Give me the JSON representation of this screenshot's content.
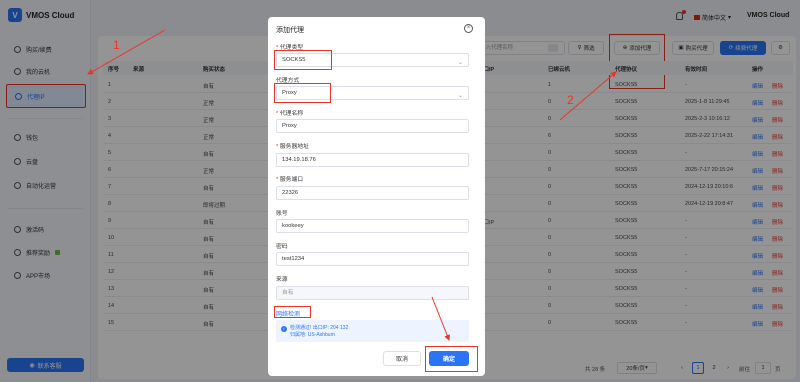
{
  "app": {
    "name": "VMOS Cloud",
    "logo_letter": "V"
  },
  "sidebar": {
    "items": [
      {
        "label": "购买/续费",
        "icon": "plus-circle-icon"
      },
      {
        "label": "我的云机",
        "icon": "phone-icon"
      },
      {
        "label": "代理IP",
        "icon": "globe-icon",
        "active": true
      },
      {
        "label": "钱包",
        "icon": "wallet-icon"
      },
      {
        "label": "云盘",
        "icon": "cloud-icon"
      },
      {
        "label": "自动化运营",
        "icon": "automation-icon"
      },
      {
        "label": "激活码",
        "icon": "code-icon"
      },
      {
        "label": "推荐奖励",
        "icon": "gift-icon"
      },
      {
        "label": "APP市场",
        "icon": "store-icon"
      }
    ],
    "support_button": "联系客服"
  },
  "topbar": {
    "language": "简体中文",
    "user": "VMOS Cloud"
  },
  "toolbar": {
    "search_placeholder": "输入代理名称",
    "filter_label": "筛选",
    "add_proxy_label": "添加代理",
    "buy_proxy_label": "购买代理",
    "renew_label": "续费代理"
  },
  "table": {
    "headers": [
      "序号",
      "来源",
      "购买状态",
      "出口IP",
      "已绑云机",
      "代理协议",
      "有效时间",
      "操作"
    ],
    "rows": [
      {
        "no": "1",
        "status": "自有",
        "ip": "",
        "bound": "1",
        "protocol": "SOCKS5",
        "time": "-"
      },
      {
        "no": "2",
        "status": "正常",
        "ip": "",
        "bound": "0",
        "protocol": "SOCKS5",
        "time": "2025-1-8 11:29:45"
      },
      {
        "no": "3",
        "status": "正常",
        "ip": "",
        "bound": "0",
        "protocol": "SOCKS5",
        "time": "2025-2-3 10:16:12"
      },
      {
        "no": "4",
        "status": "正常",
        "ip": "",
        "bound": "6",
        "protocol": "SOCKS5",
        "time": "2025-2-22 17:14:31"
      },
      {
        "no": "5",
        "status": "自有",
        "ip": "",
        "bound": "0",
        "protocol": "SOCKS5",
        "time": "-"
      },
      {
        "no": "6",
        "status": "正常",
        "ip": "",
        "bound": "0",
        "protocol": "SOCKS5",
        "time": "2025-7-17 20:15:24"
      },
      {
        "no": "7",
        "status": "自有",
        "ip": "",
        "bound": "0",
        "protocol": "SOCKS5",
        "time": "2024-12-19 20:10:6"
      },
      {
        "no": "8",
        "status": "即将过期",
        "ip": "",
        "bound": "0",
        "protocol": "SOCKS5",
        "time": "2024-12-19 20:8:47"
      },
      {
        "no": "9",
        "status": "自有",
        "ip": "出口IP",
        "bound": "0",
        "protocol": "SOCKS5",
        "time": "-"
      },
      {
        "no": "10",
        "status": "自有",
        "ip": "",
        "bound": "0",
        "protocol": "SOCKS5",
        "time": "-"
      },
      {
        "no": "11",
        "status": "自有",
        "ip": "",
        "bound": "0",
        "protocol": "SOCKS5",
        "time": "-"
      },
      {
        "no": "12",
        "status": "自有",
        "ip": "",
        "bound": "0",
        "protocol": "SOCKS5",
        "time": "-"
      },
      {
        "no": "13",
        "status": "自有",
        "ip": "",
        "bound": "0",
        "protocol": "SOCKS5",
        "time": "-"
      },
      {
        "no": "14",
        "status": "自有",
        "ip": "",
        "bound": "0",
        "protocol": "SOCKS5",
        "time": "-"
      },
      {
        "no": "15",
        "status": "自有",
        "ip": "",
        "bound": "0",
        "protocol": "SOCKS5",
        "time": "-"
      }
    ],
    "edit_label": "编辑",
    "delete_label": "删除"
  },
  "pager": {
    "total": "共 28 条",
    "page_size": "20条/页",
    "pages": [
      "1",
      "2"
    ],
    "goto_prefix": "前往",
    "goto_value": "1",
    "goto_suffix": "页"
  },
  "modal": {
    "title": "添加代理",
    "proxy_type_label": "代理类型",
    "proxy_type_value": "SOCKS5",
    "proxy_mode_label": "代理方式",
    "proxy_mode_value": "Proxy",
    "proxy_name_label": "代理名称",
    "proxy_name_value": "Proxy",
    "server_label": "服务器地址",
    "server_value": "134.19.18.76",
    "port_label": "服务端口",
    "port_value": "22326",
    "account_label": "账号",
    "account_value": "kookeey",
    "password_label": "密码",
    "password_value": "test1234",
    "source_label": "来源",
    "source_value": "自有",
    "net_check_label": "网络检测",
    "result_line1": "检测通过! 出口IP: 204 132",
    "result_line2": "归属地: US-Ashburn",
    "cancel_label": "取消",
    "ok_label": "确定"
  },
  "annotations": {
    "n1": "1",
    "n2": "2"
  },
  "colors": {
    "accent": "#2a74f5",
    "annotation": "#e8342a"
  }
}
